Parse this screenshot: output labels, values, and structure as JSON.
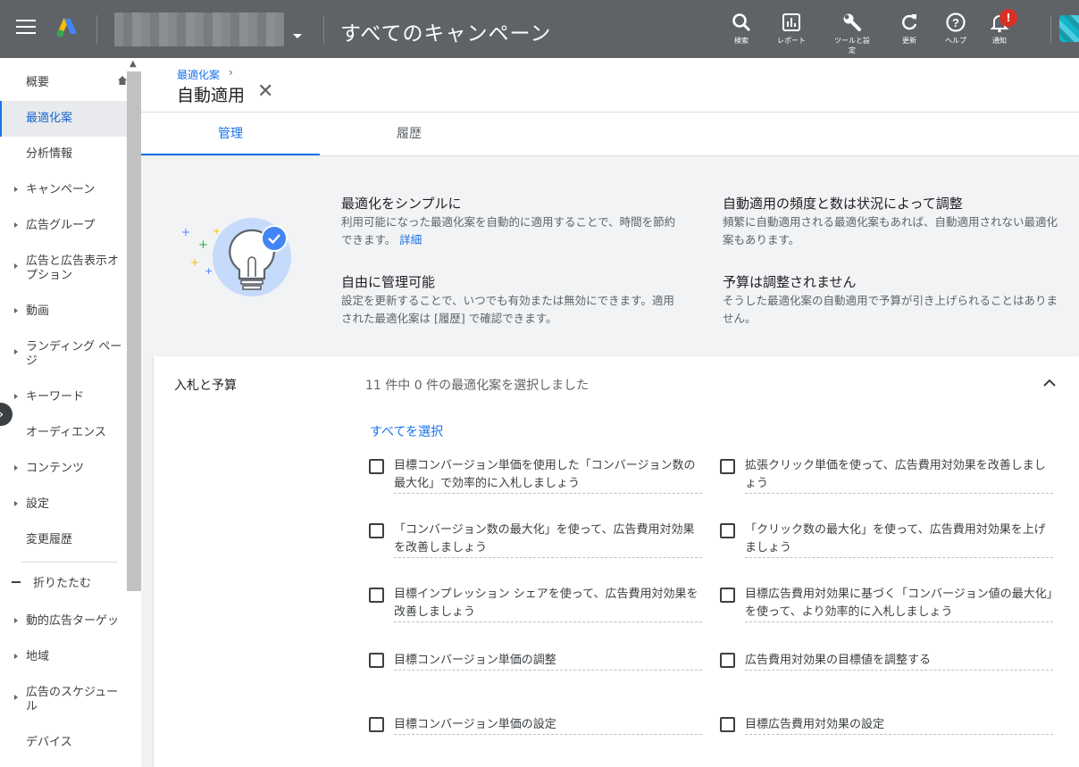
{
  "header": {
    "title": "すべてのキャンペーン",
    "tools": [
      {
        "icon": "search-icon",
        "label": "検索"
      },
      {
        "icon": "reports-icon",
        "label": "レポート"
      },
      {
        "icon": "wrench-icon",
        "label": "ツールと設定"
      },
      {
        "icon": "refresh-icon",
        "label": "更新"
      },
      {
        "icon": "help-icon",
        "label": "ヘルプ"
      },
      {
        "icon": "bell-icon",
        "label": "通知"
      }
    ],
    "notification_badge": "!"
  },
  "sidebar": {
    "items": [
      {
        "label": "概要"
      },
      {
        "label": "最適化案"
      },
      {
        "label": "分析情報"
      },
      {
        "label": "キャンペーン"
      },
      {
        "label": "広告グループ"
      },
      {
        "label": "広告と広告表示オプション"
      },
      {
        "label": "動画"
      },
      {
        "label": "ランディング ページ"
      },
      {
        "label": "キーワード"
      },
      {
        "label": "オーディエンス"
      },
      {
        "label": "コンテンツ"
      },
      {
        "label": "設定"
      },
      {
        "label": "変更履歴"
      },
      {
        "label": "折りたたむ"
      },
      {
        "label": "動的広告ターゲッ"
      },
      {
        "label": "地域"
      },
      {
        "label": "広告のスケジュール"
      },
      {
        "label": "デバイス"
      }
    ]
  },
  "breadcrumb": {
    "parent": "最適化案",
    "separator": "›"
  },
  "page": {
    "title": "自動適用",
    "close": "✕"
  },
  "tabs": [
    {
      "label": "管理"
    },
    {
      "label": "履歴"
    }
  ],
  "hero": {
    "blocks": [
      {
        "heading": "最適化をシンプルに",
        "body": "利用可能になった最適化案を自動的に適用することで、時間を節約できます。",
        "link": "詳細"
      },
      {
        "heading": "自動適用の頻度と数は状況によって調整",
        "body": "頻繁に自動適用される最適化案もあれば、自動適用されない最適化案もあります。"
      },
      {
        "heading": "自由に管理可能",
        "body": "設定を更新することで、いつでも有効または無効にできます。適用された最適化案は [履歴] で確認できます。"
      },
      {
        "heading": "予算は調整されません",
        "body": "そうした最適化案の自動適用で予算が引き上げられることはありません。"
      }
    ]
  },
  "section": {
    "title": "入札と予算",
    "status": "11 件中 0 件の最適化案を選択しました",
    "select_all": "すべてを選択",
    "options": [
      {
        "label": "目標コンバージョン単価を使用した「コンバージョン数の最大化」で効率的に入札しましょう",
        "checked": false
      },
      {
        "label": "拡張クリック単価を使って、広告費用対効果を改善しましょう",
        "checked": false
      },
      {
        "label": "「コンバージョン数の最大化」を使って、広告費用対効果を改善しましょう",
        "checked": false
      },
      {
        "label": "「クリック数の最大化」を使って、広告費用対効果を上げましょう",
        "checked": false
      },
      {
        "label": "目標インプレッション シェアを使って、広告費用対効果を改善しましょう",
        "checked": false
      },
      {
        "label": "目標広告費用対効果に基づく「コンバージョン値の最大化」を使って、より効率的に入札しましょう",
        "checked": false
      },
      {
        "label": "目標コンバージョン単価の調整",
        "checked": false
      },
      {
        "label": "広告費用対効果の目標値を調整する",
        "checked": false
      },
      {
        "label": "目標コンバージョン単価の設定",
        "checked": false
      },
      {
        "label": "目標広告費用対効果の設定",
        "checked": false
      }
    ]
  },
  "colors": {
    "topbar": "#5f6368",
    "accent": "#1a73e8",
    "badge": "#d93025"
  }
}
